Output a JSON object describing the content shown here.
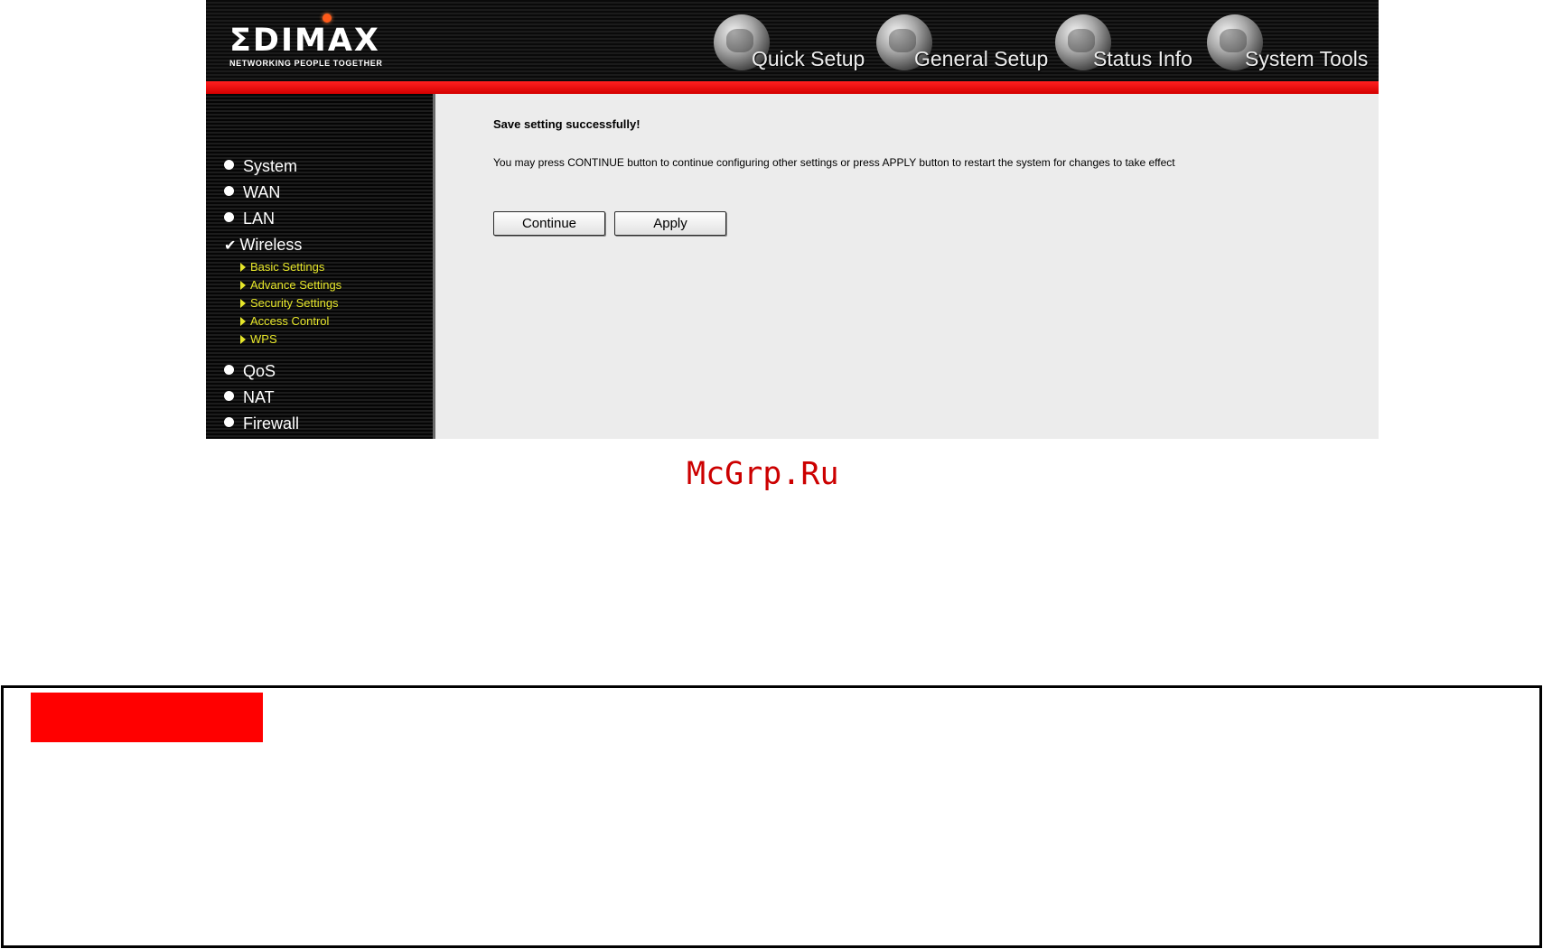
{
  "brand": {
    "logo_text": "ΣDIMAX",
    "tagline": "NETWORKING PEOPLE TOGETHER"
  },
  "top_nav": [
    {
      "label": "Quick Setup",
      "icon": "globe-icon"
    },
    {
      "label": "General Setup",
      "icon": "gears-icon"
    },
    {
      "label": "Status Info",
      "icon": "status-icon"
    },
    {
      "label": "System Tools",
      "icon": "tools-icon"
    }
  ],
  "sidebar": {
    "items": [
      {
        "label": "System"
      },
      {
        "label": "WAN"
      },
      {
        "label": "LAN"
      },
      {
        "label": "Wireless",
        "checked": true
      },
      {
        "label": "QoS"
      },
      {
        "label": "NAT"
      },
      {
        "label": "Firewall"
      }
    ],
    "wireless_sub": [
      {
        "label": "Basic Settings"
      },
      {
        "label": "Advance Settings"
      },
      {
        "label": "Security Settings"
      },
      {
        "label": "Access Control"
      },
      {
        "label": "WPS"
      }
    ]
  },
  "main": {
    "title": "Save setting successfully!",
    "message": "You may press CONTINUE button to continue configuring other settings or press APPLY button to restart the system for changes to take effect",
    "continue_label": "Continue",
    "apply_label": "Apply"
  },
  "watermark": "McGrp.Ru",
  "colors": {
    "accent_red": "#ff0000",
    "submenu_yellow": "#e6e62a",
    "content_bg": "#ececec",
    "watermark": "#cc0000"
  }
}
